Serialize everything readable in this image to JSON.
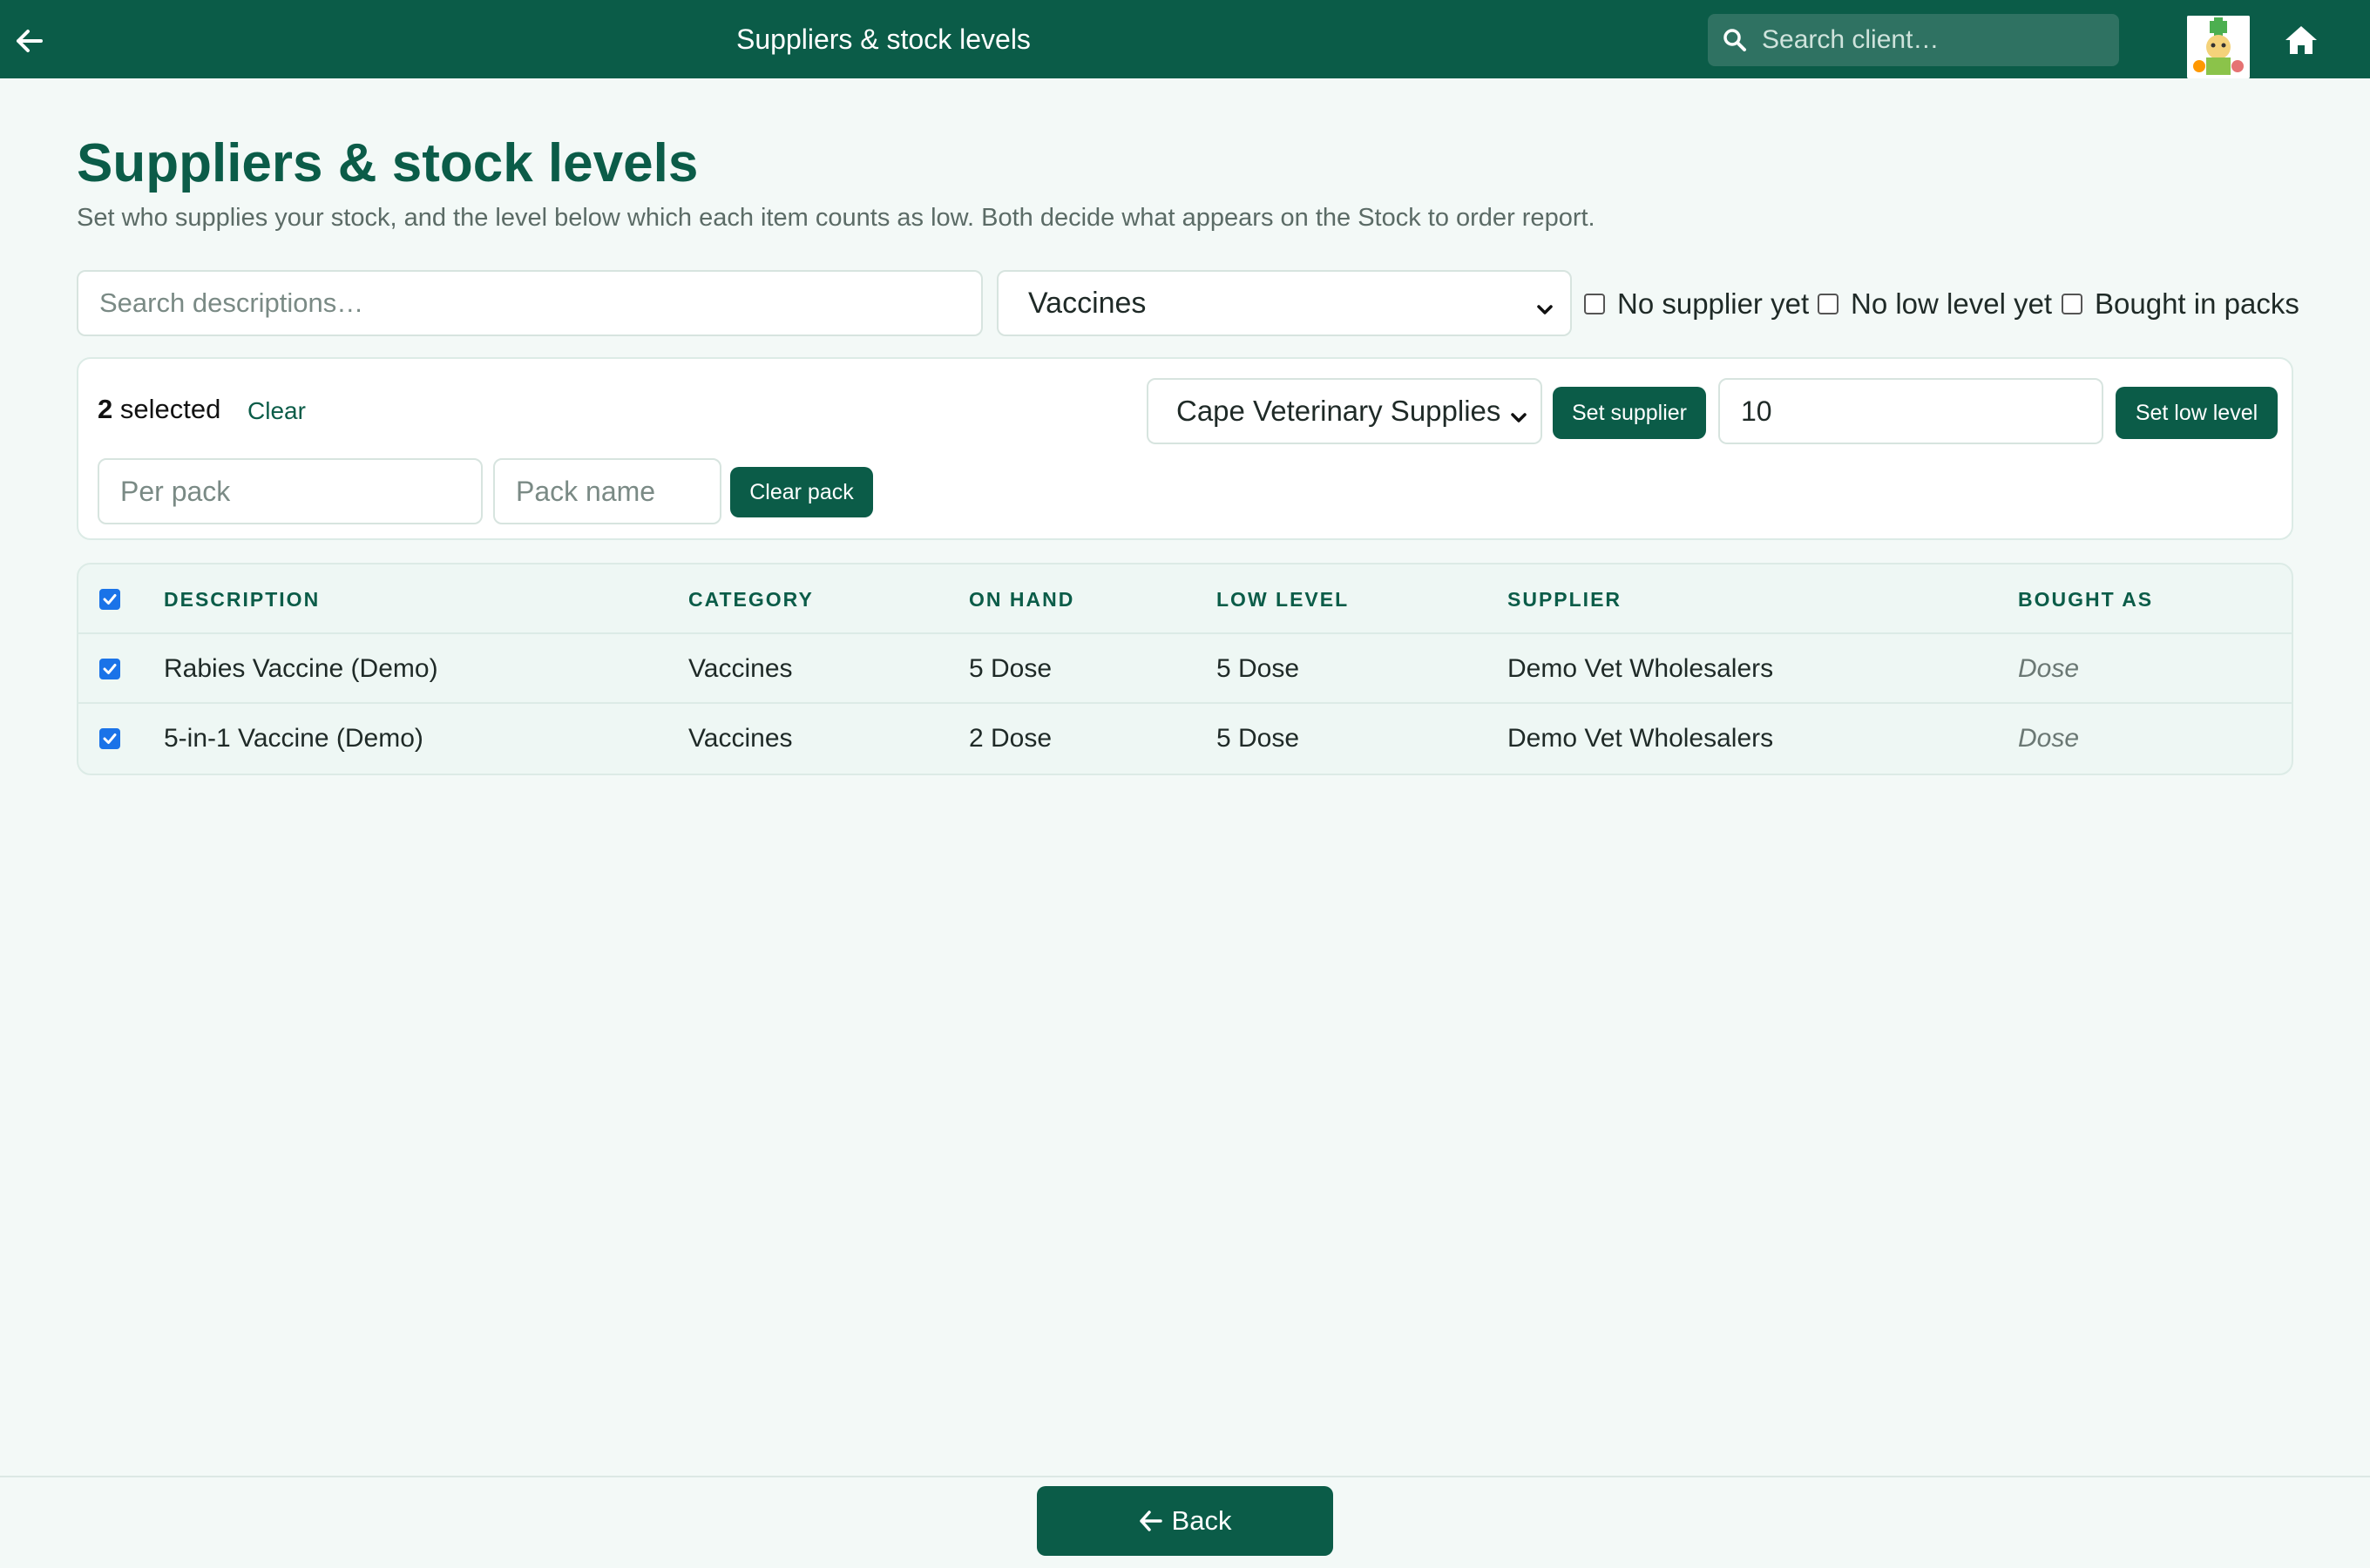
{
  "topbar": {
    "title": "Suppliers & stock levels",
    "search_placeholder": "Search client…"
  },
  "page": {
    "title": "Suppliers & stock levels",
    "subtitle": "Set who supplies your stock, and the level below which each item counts as low. Both decide what appears on the Stock to order report."
  },
  "filters": {
    "search_placeholder": "Search descriptions…",
    "category_selected": "Vaccines",
    "checkboxes": [
      {
        "label": "No supplier yet",
        "checked": false
      },
      {
        "label": "No low level yet",
        "checked": false
      },
      {
        "label": "Bought in packs",
        "checked": false
      }
    ]
  },
  "bulk": {
    "count": "2",
    "selected_label": " selected",
    "clear_label": "Clear",
    "supplier_selected": "Cape Veterinary Supplies",
    "set_supplier_label": "Set supplier",
    "low_level_value": "10",
    "set_low_level_label": "Set low level",
    "per_pack_placeholder": "Per pack",
    "pack_name_placeholder": "Pack name",
    "clear_pack_label": "Clear pack"
  },
  "table": {
    "headers": {
      "description": "DESCRIPTION",
      "category": "CATEGORY",
      "on_hand": "ON HAND",
      "low_level": "LOW LEVEL",
      "supplier": "SUPPLIER",
      "bought_as": "BOUGHT AS"
    },
    "rows": [
      {
        "checked": true,
        "description": "Rabies Vaccine (Demo)",
        "category": "Vaccines",
        "on_hand": "5 Dose",
        "low_level": "5 Dose",
        "supplier": "Demo Vet Wholesalers",
        "bought_as": "Dose"
      },
      {
        "checked": true,
        "description": "5-in-1 Vaccine (Demo)",
        "category": "Vaccines",
        "on_hand": "2 Dose",
        "low_level": "5 Dose",
        "supplier": "Demo Vet Wholesalers",
        "bought_as": "Dose"
      }
    ]
  },
  "footer": {
    "back_label": "Back"
  },
  "colors": {
    "brand": "#0b5c48",
    "background": "#f3f9f7",
    "checkbox_checked": "#1a73e8"
  },
  "icons": [
    "back-arrow-icon",
    "search-icon",
    "logo",
    "home-icon",
    "chevron-down-icon",
    "check-icon"
  ]
}
